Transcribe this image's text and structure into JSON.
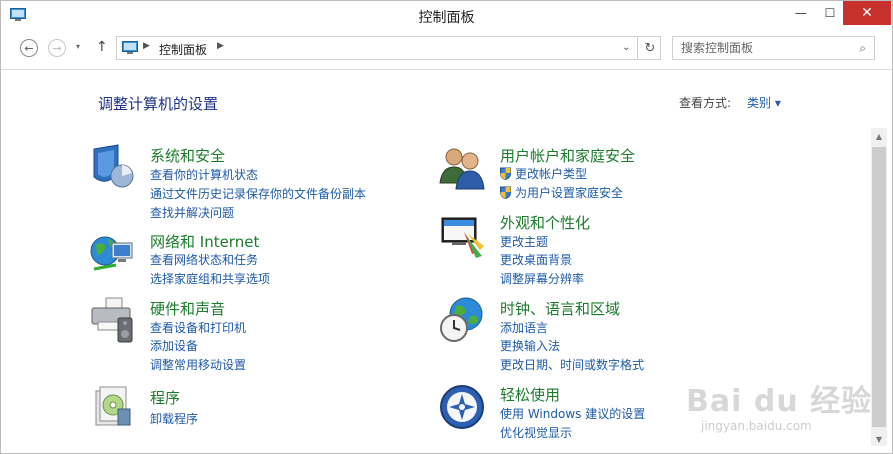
{
  "window": {
    "title": "控制面板"
  },
  "titlebar": {
    "min_glyph": "—",
    "max_glyph": "☐",
    "close_glyph": "✕"
  },
  "nav": {
    "back_glyph": "←",
    "forward_glyph": "→",
    "recent_glyph": "▾",
    "up_glyph": "↑",
    "address": "控制面板",
    "sep_glyph": "▶",
    "dropdown_glyph": "⌄",
    "refresh_glyph": "↻",
    "search_placeholder": "搜索控制面板",
    "search_value": ""
  },
  "content": {
    "title": "调整计算机的设置",
    "view_by_label": "查看方式:",
    "view_by_value": "类别 ▾",
    "categories": [
      {
        "icon": "system-security-icon",
        "title": "系统和安全",
        "links": [
          "查看你的计算机状态",
          "通过文件历史记录保存你的文件备份副本",
          "查找并解决问题"
        ]
      },
      {
        "icon": "network-internet-icon",
        "title": "网络和 Internet",
        "links": [
          "查看网络状态和任务",
          "选择家庭组和共享选项"
        ]
      },
      {
        "icon": "hardware-sound-icon",
        "title": "硬件和声音",
        "links": [
          "查看设备和打印机",
          "添加设备",
          "调整常用移动设置"
        ]
      },
      {
        "icon": "programs-icon",
        "title": "程序",
        "links": [
          "卸载程序"
        ]
      },
      {
        "icon": "user-accounts-icon",
        "title": "用户帐户和家庭安全",
        "links": [
          "更改帐户类型",
          "为用户设置家庭安全"
        ]
      },
      {
        "icon": "appearance-icon",
        "title": "外观和个性化",
        "links": [
          "更改主题",
          "更改桌面背景",
          "调整屏幕分辨率"
        ]
      },
      {
        "icon": "clock-language-region-icon",
        "title": "时钟、语言和区域",
        "links": [
          "添加语言",
          "更换输入法",
          "更改日期、时间或数字格式"
        ]
      },
      {
        "icon": "ease-of-access-icon",
        "title": "轻松使用",
        "links": [
          "使用 Windows 建议的设置",
          "优化视觉显示"
        ]
      }
    ]
  },
  "scrollbar": {
    "up_glyph": "▲",
    "down_glyph": "▼"
  },
  "watermark": {
    "logo": "Bai du 经验",
    "url": "jingyan.baidu.com"
  },
  "colors": {
    "link": "#1e5aa8",
    "category_title": "#1c7c2c",
    "page_title": "#1e3287",
    "close_button": "#c7302b"
  }
}
